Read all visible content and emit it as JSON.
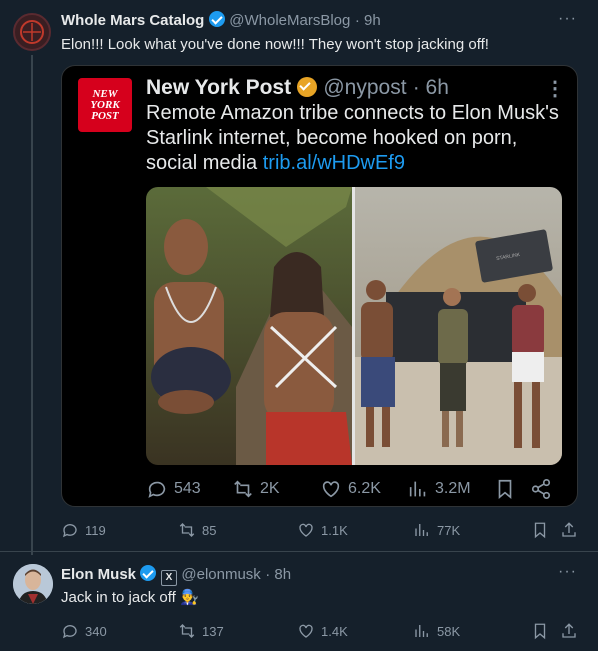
{
  "tweet1": {
    "author_name": "Whole Mars Catalog",
    "handle": "@WholeMarsBlog",
    "time": "· 9h",
    "text": "Elon!!! Look what you've done now!!! They won't stop jacking off!",
    "more": "···",
    "actions": {
      "replies": "119",
      "retweets": "85",
      "likes": "1.1K",
      "views": "77K"
    }
  },
  "quoted": {
    "logo_text": "NEW YORK POST",
    "author_name": "New York Post",
    "handle": "@nypost",
    "time": "· 6h",
    "text": "Remote Amazon tribe connects to Elon Musk's Starlink internet, become hooked on porn, social media",
    "link": "trib.al/wHDwEf9",
    "more": "⋮",
    "actions": {
      "replies": "543",
      "retweets": "2K",
      "likes": "6.2K",
      "views": "3.2M"
    },
    "image_right_text": "STARLINK"
  },
  "tweet2": {
    "author_name": "Elon Musk",
    "handle": "@elonmusk",
    "time": "· 8h",
    "text": "Jack in to jack off 👨‍🔧",
    "more": "···",
    "actions": {
      "replies": "340",
      "retweets": "137",
      "likes": "1.4K",
      "views": "58K"
    }
  },
  "colors": {
    "background": "#15202b",
    "card_background": "#000000",
    "accent": "#1d9bf0",
    "muted": "#8b98a5",
    "nypost_red": "#d6001c"
  }
}
